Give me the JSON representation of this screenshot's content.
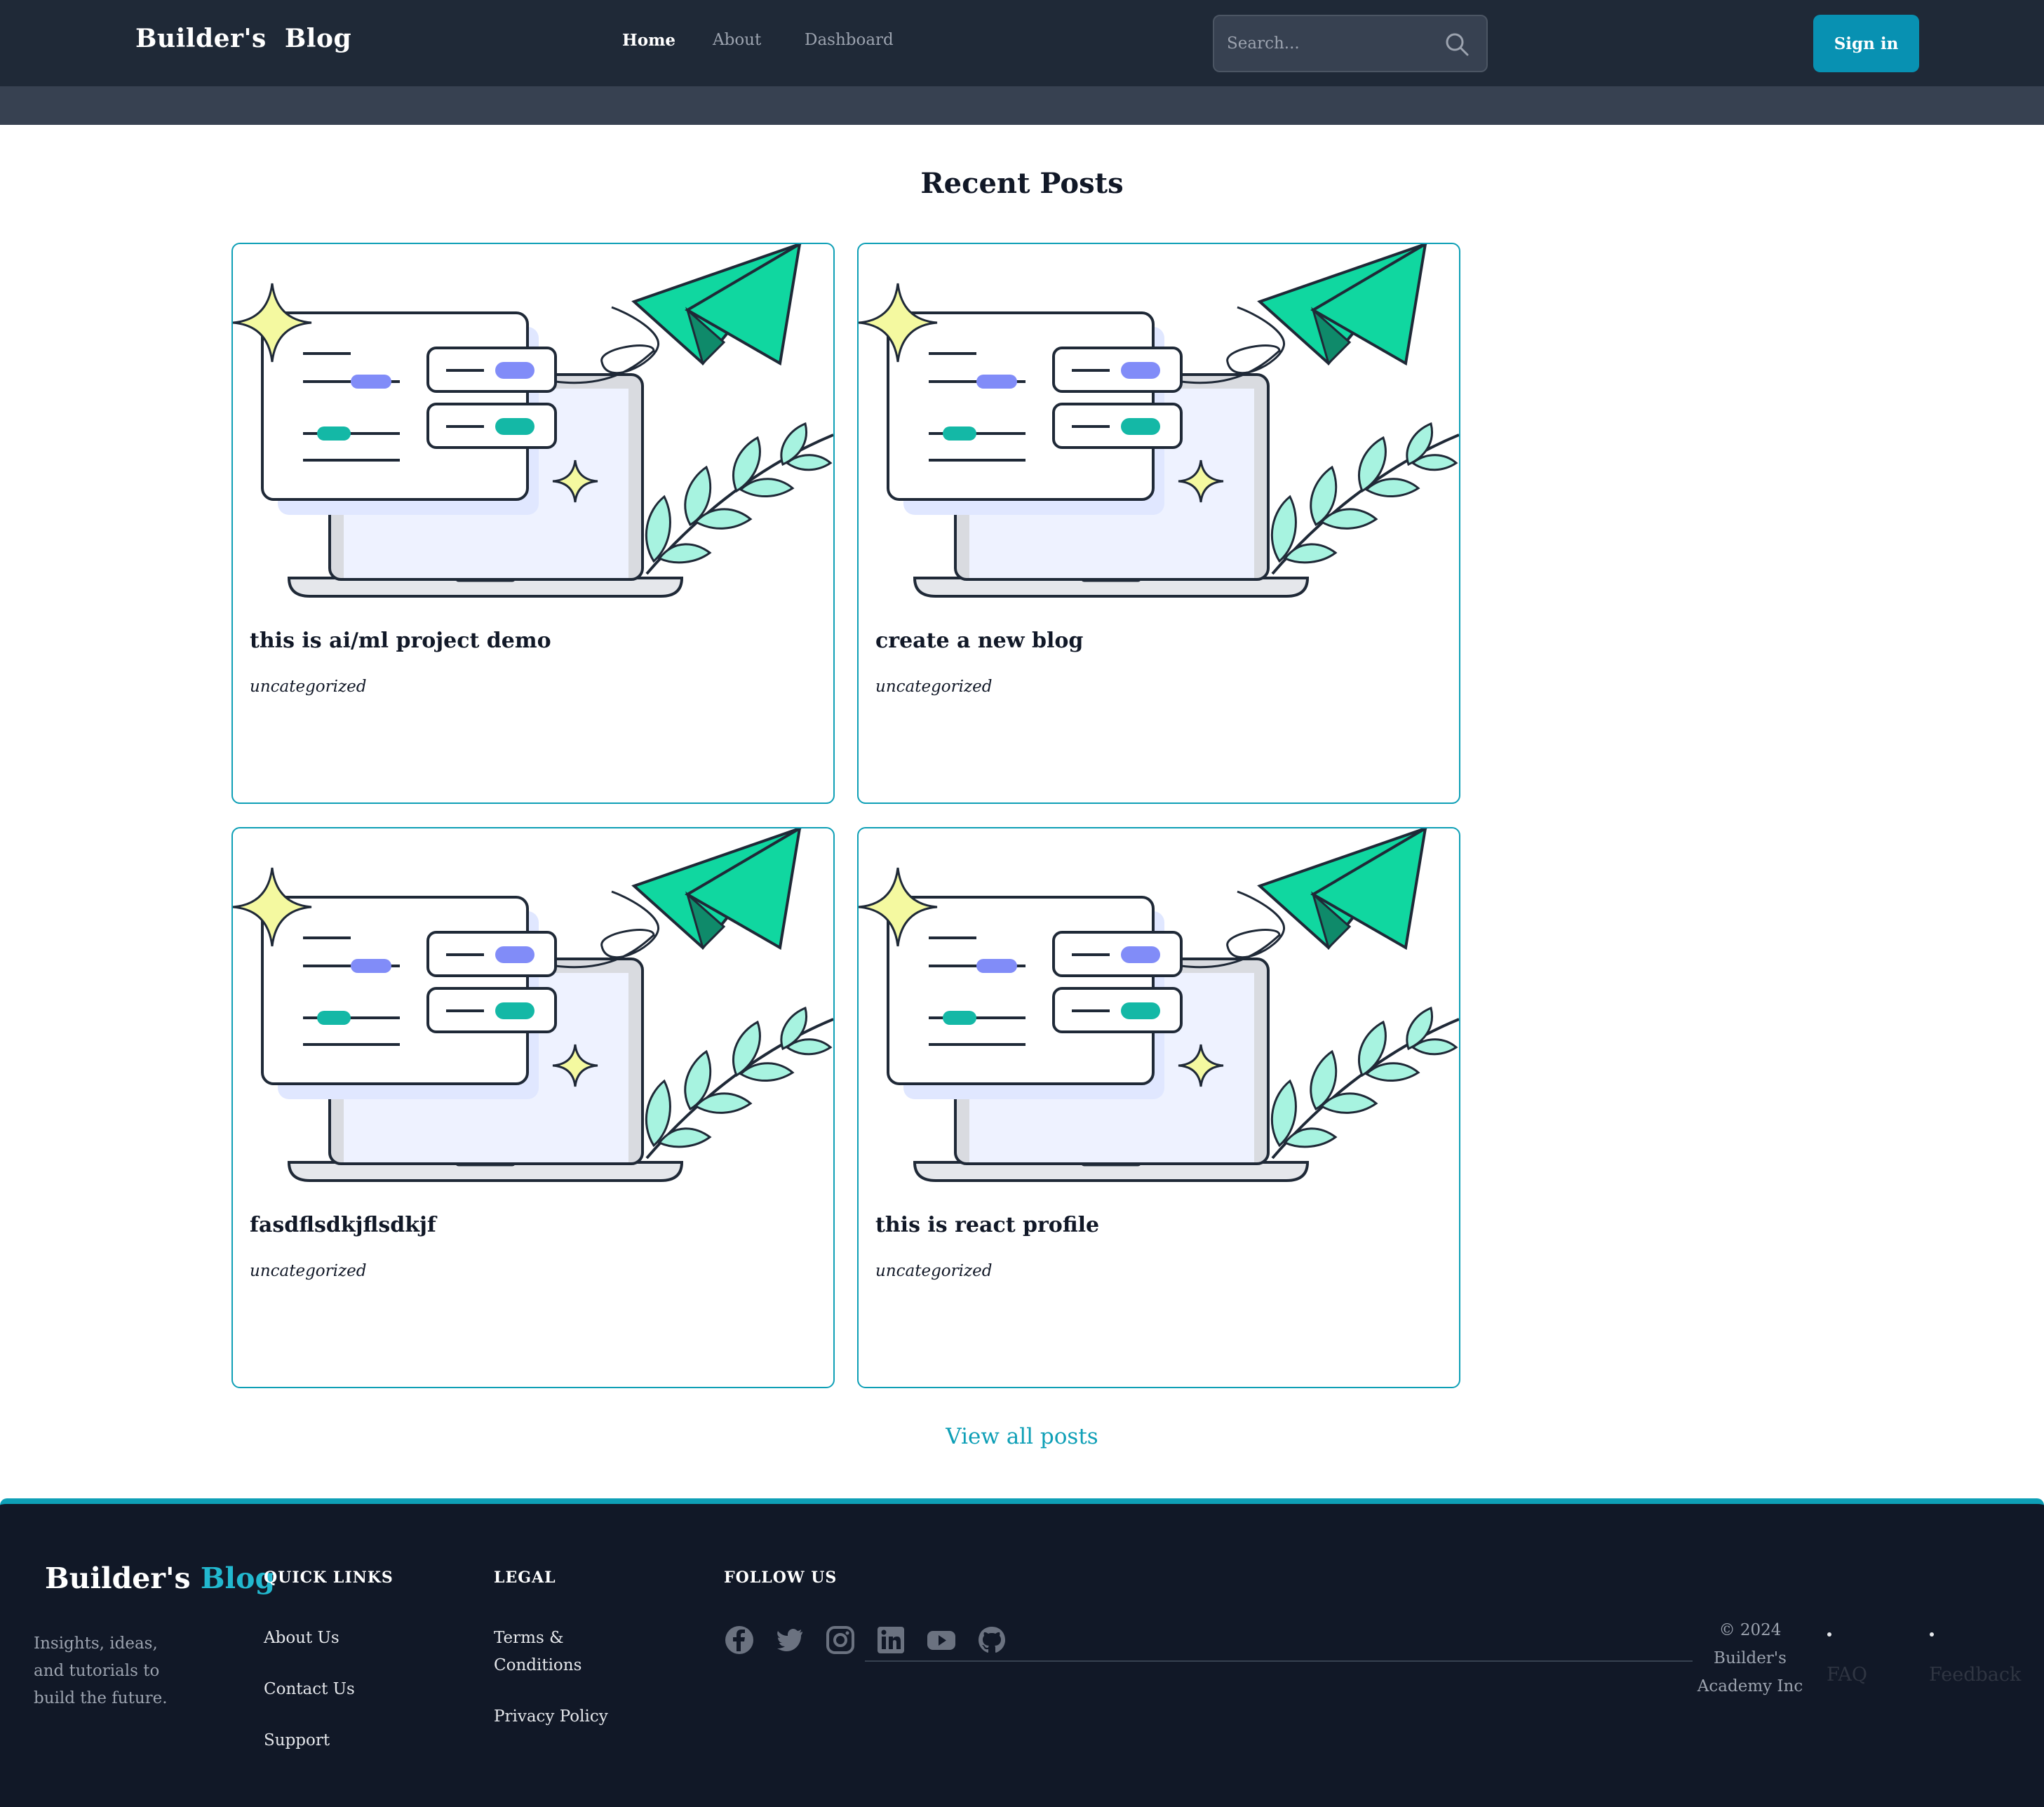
{
  "header": {
    "logo": "Builder's  Blog",
    "nav": [
      "Home",
      "About",
      "Dashboard"
    ],
    "search_placeholder": "Search...",
    "signin_label": "Sign in"
  },
  "main": {
    "heading": "Recent Posts",
    "posts": [
      {
        "title": "this is ai/ml project demo",
        "category": "uncategorized"
      },
      {
        "title": "create a new blog",
        "category": "uncategorized"
      },
      {
        "title": "fasdflsdkjflsdkjf",
        "category": "uncategorized"
      },
      {
        "title": "this is react profile",
        "category": "uncategorized"
      }
    ],
    "view_all": "View all posts"
  },
  "footer": {
    "logo_main": "Builder's",
    "logo_accent": "Blog",
    "tagline": "Insights, ideas, and tutorials to build the future.",
    "quick_links": {
      "heading": "QUICK LINKS",
      "items": [
        "About Us",
        "Contact Us",
        "Support"
      ]
    },
    "legal": {
      "heading": "LEGAL",
      "items": [
        "Terms & Conditions",
        "Privacy Policy"
      ]
    },
    "follow": {
      "heading": "FOLLOW US",
      "icons": [
        "facebook-icon",
        "twitter-icon",
        "instagram-icon",
        "linkedin-icon",
        "youtube-icon",
        "github-icon"
      ]
    },
    "copyright": "© 2024 Builder's Academy Inc",
    "extra_links": [
      "FAQ",
      "Feedback"
    ]
  },
  "colors": {
    "nav_bg": "#1f2937",
    "nav_band": "#374151",
    "accent": "#0e9fb6",
    "signin_bg": "#0891b2",
    "footer_bg": "#111827"
  }
}
